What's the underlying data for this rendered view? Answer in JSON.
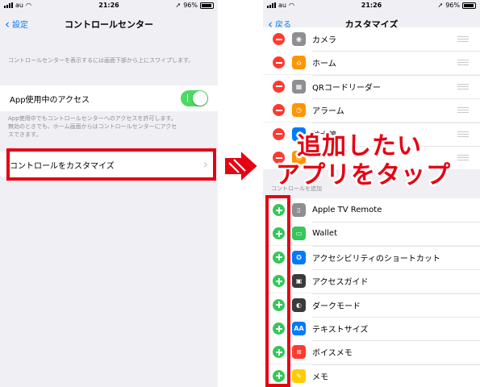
{
  "status_bar": {
    "carrier": "au",
    "time": "21:26",
    "battery": "96%",
    "battery_level": 0.96
  },
  "left_screen": {
    "nav": {
      "back_label": "設定",
      "title": "コントロールセンター"
    },
    "intro_note": "コントロールセンターを表示するには画面下部から上にスワイプします。",
    "access_label": "App使用中のアクセス",
    "access_toggle_on": true,
    "access_note_line1": "App使用中でもコントロールセンターへのアクセスを許可します。",
    "access_note_line2": "無効のときでも、ホーム画面からはコントロールセンターにアクセ",
    "access_note_line3": "スできます。",
    "customize_label": "コントロールをカスタマイズ"
  },
  "right_screen": {
    "nav": {
      "back_label": "戻る",
      "title": "カスタマイズ"
    },
    "included": [
      {
        "label": "カメラ",
        "icon": "camera-icon",
        "color": "#8e8e93"
      },
      {
        "label": "ホーム",
        "icon": "home-icon",
        "color": "#ff9500"
      },
      {
        "label": "QRコードリーダー",
        "icon": "qr-code-icon",
        "color": "#8e8e93"
      },
      {
        "label": "アラーム",
        "icon": "alarm-icon",
        "color": "#ff9500"
      },
      {
        "label": "拡大鏡",
        "icon": "magnifier-icon",
        "color": "#007aff"
      },
      {
        "label": "",
        "icon": "timer-icon",
        "color": "#ff9500"
      }
    ],
    "more_header": "コントロールを追加",
    "more": [
      {
        "label": "Apple TV Remote",
        "icon": "apple-tv-remote-icon",
        "color": "#8e8e93"
      },
      {
        "label": "Wallet",
        "icon": "wallet-icon",
        "color": "#34c759"
      },
      {
        "label": "アクセシビリティのショートカット",
        "icon": "accessibility-icon",
        "color": "#007aff"
      },
      {
        "label": "アクセスガイド",
        "icon": "lock-icon",
        "color": "#3a3a3c"
      },
      {
        "label": "ダークモード",
        "icon": "dark-mode-icon",
        "color": "#3a3a3c"
      },
      {
        "label": "テキストサイズ",
        "icon": "text-size-icon",
        "color": "#007aff"
      },
      {
        "label": "ボイスメモ",
        "icon": "voice-memo-icon",
        "color": "#ff3b30"
      },
      {
        "label": "メモ",
        "icon": "notes-icon",
        "color": "#ffcc00"
      }
    ]
  },
  "annotation": {
    "line1": "追加したい",
    "line2": "アプリをタップ",
    "color": "#e60012"
  }
}
